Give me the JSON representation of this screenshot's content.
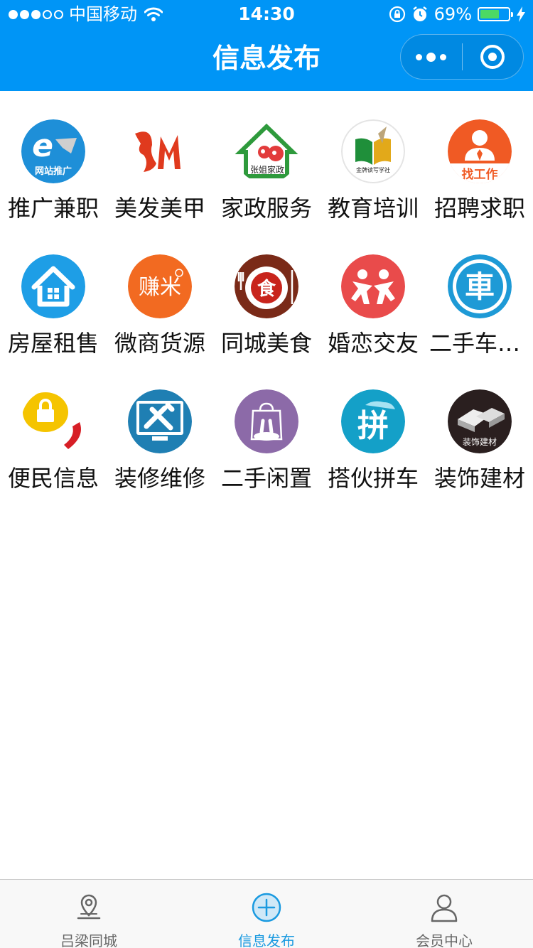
{
  "status_bar": {
    "signal": "●●●○○",
    "carrier": "中国移动",
    "time": "14:30",
    "battery_percent": "69%",
    "battery_level": 0.69,
    "icons": [
      "wifi-icon",
      "orientation-lock-icon",
      "alarm-icon",
      "battery-icon",
      "charging-bolt-icon"
    ]
  },
  "nav": {
    "title": "信息发布",
    "more_icon": "ellipsis-icon",
    "close_icon": "target-circle-icon"
  },
  "categories": [
    {
      "label": "推广兼职",
      "icon": "web-promotion-icon",
      "icon_text": "网站推广",
      "color": "#1e8fd8"
    },
    {
      "label": "美发美甲",
      "icon": "hair-salon-icon",
      "color": "#e03a1e"
    },
    {
      "label": "家政服务",
      "icon": "housekeeping-icon",
      "icon_text": "张姐家政",
      "color": "#2e9a3c"
    },
    {
      "label": "教育培训",
      "icon": "education-book-icon",
      "icon_text": "金牌读写学社",
      "color": "#1f8f3a"
    },
    {
      "label": "招聘求职",
      "icon": "job-search-icon",
      "icon_text": "找工作",
      "color": "#f05a24"
    },
    {
      "label": "房屋租售",
      "icon": "house-icon",
      "color": "#1e9ee6"
    },
    {
      "label": "微商货源",
      "icon": "zhuanmi-icon",
      "icon_text": "赚米",
      "color": "#f26a21"
    },
    {
      "label": "同城美食",
      "icon": "food-dining-icon",
      "icon_text": "食",
      "color": "#7a2a18"
    },
    {
      "label": "婚恋交友",
      "icon": "dating-people-icon",
      "color": "#e94b4b"
    },
    {
      "label": "二手车交易",
      "icon": "used-car-icon",
      "icon_text": "車",
      "color": "#1e9ad6"
    },
    {
      "label": "便民信息",
      "icon": "lock-phone-icon",
      "color": "#f5c400"
    },
    {
      "label": "装修维修",
      "icon": "repair-tools-icon",
      "color": "#1f7fb3"
    },
    {
      "label": "二手闲置",
      "icon": "idle-bag-icon",
      "color": "#8c6aa8"
    },
    {
      "label": "搭伙拼车",
      "icon": "carpool-icon",
      "icon_text": "拼",
      "color": "#14a0c8"
    },
    {
      "label": "装饰建材",
      "icon": "building-materials-icon",
      "icon_text": "装饰建材",
      "color": "#2a1f1f"
    }
  ],
  "tabbar": {
    "items": [
      {
        "label": "吕梁同城",
        "icon": "location-pin-icon",
        "active": false
      },
      {
        "label": "信息发布",
        "icon": "add-circle-icon",
        "active": true
      },
      {
        "label": "会员中心",
        "icon": "user-icon",
        "active": false
      }
    ],
    "active_color": "#1a9ae0",
    "inactive_color": "#666666"
  },
  "colors": {
    "header": "#0095f6",
    "background": "#ffffff",
    "tabbar_bg": "#f8f8f8"
  }
}
